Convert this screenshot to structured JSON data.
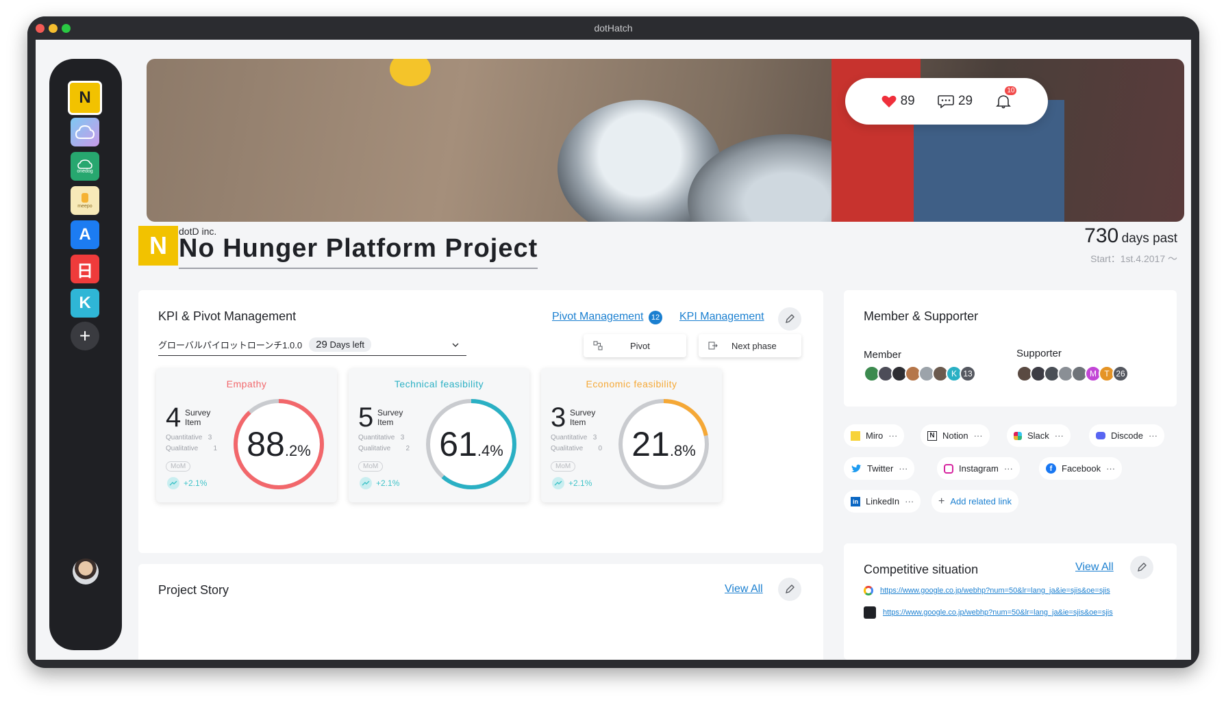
{
  "window": {
    "title": "dotHatch"
  },
  "sidebar": {
    "apps": [
      {
        "name": "N",
        "color": "#f2c200"
      },
      {
        "name": "cloud",
        "color": "#5fb6e8"
      },
      {
        "name": "onedog",
        "color": "#27a76f",
        "label": "onedog"
      },
      {
        "name": "meepo",
        "color": "#f7e9b8",
        "label": "meepo"
      },
      {
        "name": "A",
        "color": "#1c7cf2"
      },
      {
        "name": "日",
        "color": "#ef3b3b"
      },
      {
        "name": "K",
        "color": "#2fb6d6"
      }
    ],
    "add_label": "+"
  },
  "hero_stats": {
    "likes": "89",
    "comments": "29",
    "notifications": "10"
  },
  "project": {
    "logo": "N",
    "company": "dotD inc.",
    "title": "No Hunger Platform Project",
    "days_num": "730",
    "days_unit": "days past",
    "start": "Start：1st.4.2017 ～"
  },
  "kpi": {
    "title": "KPI & Pivot Management",
    "pivot_link": "Pivot Management",
    "pivot_badge": "12",
    "kpi_link": "KPI Management",
    "select_value": "グローバルパイロットローンチ1.0.0",
    "days_left_num": "29",
    "days_left_label": "Days left",
    "pivot_btn": "Pivot",
    "next_btn": "Next phase",
    "cards": [
      {
        "label": "Empathy",
        "color": "#f2676b",
        "survey": "4",
        "survey_label_1": "Survey",
        "survey_label_2": "Item",
        "quant_label": "Quantitative",
        "quant": "3",
        "qual_label": "Qualitative",
        "qual": "1",
        "mom": "MoM",
        "delta": "+2.1%",
        "value_main": "88",
        "value_dec": ".2%",
        "progress": 88.2
      },
      {
        "label": "Technical feasibility",
        "color": "#2ab0c4",
        "survey": "5",
        "survey_label_1": "Survey",
        "survey_label_2": "Item",
        "quant_label": "Quantitative",
        "quant": "3",
        "qual_label": "Qualitative",
        "qual": "2",
        "mom": "MoM",
        "delta": "+2.1%",
        "value_main": "61",
        "value_dec": ".4%",
        "progress": 61.4
      },
      {
        "label": "Economic feasibility",
        "color": "#f5a836",
        "survey": "3",
        "survey_label_1": "Survey",
        "survey_label_2": "Item",
        "quant_label": "Quantitative",
        "quant": "3",
        "qual_label": "Qualitative",
        "qual": "0",
        "mom": "MoM",
        "delta": "+2.1%",
        "value_main": "21",
        "value_dec": ".8%",
        "progress": 21.8
      }
    ]
  },
  "members": {
    "title": "Member & Supporter",
    "member_label": "Member",
    "member_more": "13",
    "member_initial": "K",
    "supporter_label": "Supporter",
    "supporter_more": "26",
    "supporter_initials": [
      "M",
      "T"
    ]
  },
  "links": [
    {
      "label": "Miro",
      "icon": "miro-icon",
      "more": "···"
    },
    {
      "label": "Notion",
      "icon": "notion-icon",
      "more": "···"
    },
    {
      "label": "Slack",
      "icon": "slack-icon",
      "more": "···"
    },
    {
      "label": "Discode",
      "icon": "discord-icon",
      "more": "···"
    },
    {
      "label": "Twitter",
      "icon": "twitter-icon",
      "more": "···"
    },
    {
      "label": "Instagram",
      "icon": "instagram-icon",
      "more": "···"
    },
    {
      "label": "Facebook",
      "icon": "facebook-icon",
      "more": "···"
    },
    {
      "label": "LinkedIn",
      "icon": "linkedin-icon",
      "more": "···"
    }
  ],
  "add_link": "Add related link",
  "competitive": {
    "title": "Competitive situation",
    "view_all": "View All",
    "urls": [
      "https://www.google.co.jp/webhp?num=50&lr=lang_ja&ie=sjis&oe=sjis",
      "https://www.google.co.jp/webhp?num=50&lr=lang_ja&ie=sjis&oe=sjis"
    ]
  },
  "story": {
    "title": "Project Story",
    "view_all": "View All"
  }
}
